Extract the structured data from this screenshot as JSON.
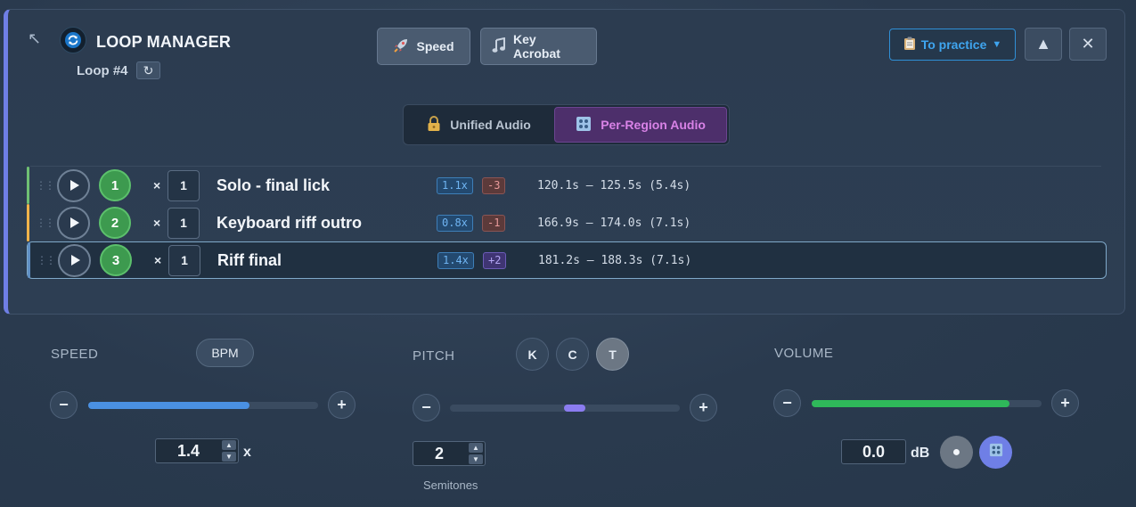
{
  "header": {
    "title": "LOOP MANAGER",
    "loop_id": "Loop #4",
    "refresh_glyph": "↻",
    "expand_glyph": "↖"
  },
  "toolbar": {
    "speed_label": "Speed",
    "key_label": "Key Acrobat",
    "practice_label": "To practice",
    "practice_caret": "▼",
    "up_glyph": "▲",
    "close_glyph": "✕"
  },
  "audio_mode": {
    "unified_label": "Unified Audio",
    "per_region_label": "Per-Region Audio",
    "selected": "per-region"
  },
  "regions": [
    {
      "index": "1",
      "count": "1",
      "name": "Solo - final lick",
      "speed": "1.1x",
      "pitch": "-3",
      "range": "120.1s – 125.5s (5.4s)",
      "color": "#6fbf73",
      "active": false
    },
    {
      "index": "2",
      "count": "1",
      "name": "Keyboard riff outro",
      "speed": "0.8x",
      "pitch": "-1",
      "range": "166.9s – 174.0s (7.1s)",
      "color": "#f0b34a",
      "active": false
    },
    {
      "index": "3",
      "count": "1",
      "name": "Riff final",
      "speed": "1.4x",
      "pitch": "+2",
      "range": "181.2s – 188.3s (7.1s)",
      "color": "#5f8fc4",
      "active": true
    }
  ],
  "times_glyph": "×",
  "speed": {
    "label": "SPEED",
    "bpm_label": "BPM",
    "value": "1.4",
    "unit": "x",
    "slider_fraction": 0.7,
    "color": "#4a90e2"
  },
  "pitch": {
    "label": "PITCH",
    "keys": [
      "K",
      "C",
      "T"
    ],
    "active_key": "T",
    "value": "2",
    "caption": "Semitones",
    "color": "#8b7cf0"
  },
  "volume": {
    "label": "VOLUME",
    "value": "0.0",
    "unit": "dB",
    "slider_fraction": 0.86,
    "color": "#2fb85a"
  },
  "glyphs": {
    "minus": "−",
    "plus": "+",
    "spin_up": "▲",
    "spin_down": "▼",
    "dot": "●"
  }
}
